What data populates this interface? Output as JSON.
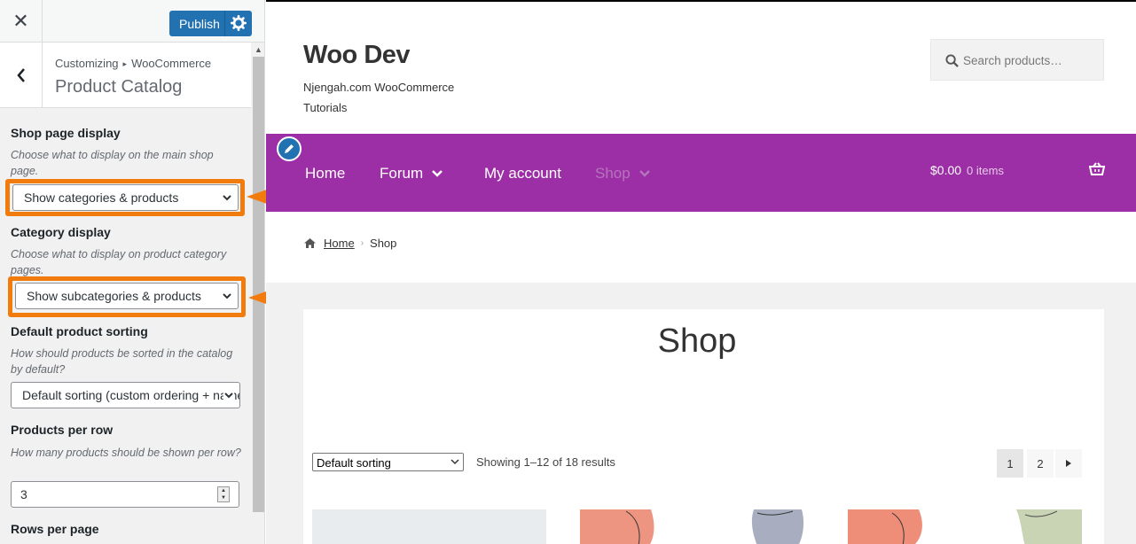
{
  "customizer": {
    "publish_label": "Publish",
    "breadcrumb": {
      "root": "Customizing",
      "parent": "WooCommerce"
    },
    "section_title": "Product Catalog",
    "controls": {
      "shop_display": {
        "label": "Shop page display",
        "description": "Choose what to display on the main shop page.",
        "value": "Show categories & products"
      },
      "category_display": {
        "label": "Category display",
        "description": "Choose what to display on product category pages.",
        "value": "Show subcategories & products"
      },
      "default_sorting": {
        "label": "Default product sorting",
        "description": "How should products be sorted in the catalog by default?",
        "value": "Default sorting (custom ordering + name)"
      },
      "products_per_row": {
        "label": "Products per row",
        "description": "How many products should be shown per row?",
        "value": "3"
      },
      "rows_per_page": {
        "label": "Rows per page"
      }
    },
    "highlight_color": "#f27b0e"
  },
  "site": {
    "title": "Woo Dev",
    "description": "Njengah.com WooCommerce Tutorials",
    "search_placeholder": "Search products…",
    "nav": [
      "Home",
      "Forum",
      "My account",
      "Shop"
    ],
    "cart": {
      "total": "$0.00",
      "items": "0 items"
    },
    "breadcrumb": {
      "home": "Home",
      "current": "Shop"
    },
    "page_title": "Shop",
    "sorting_select": "Default sorting",
    "result_count": "Showing 1–12 of 18 results",
    "pagination": [
      "1",
      "2"
    ],
    "nav_color": "#9c2fa5",
    "accent": "#2271b1"
  }
}
